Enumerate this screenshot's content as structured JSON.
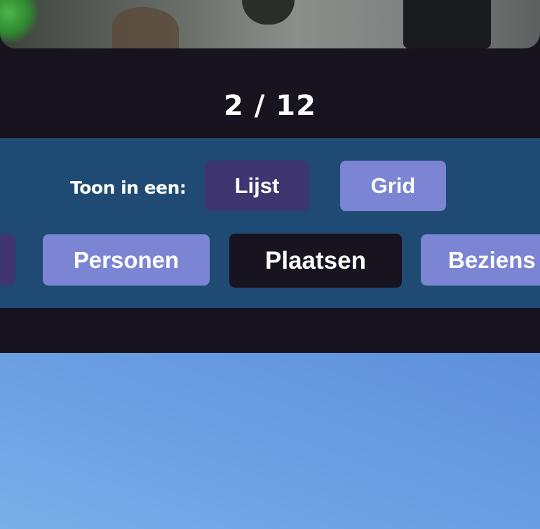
{
  "gallery": {
    "counter": "2 / 12"
  },
  "view_toggle": {
    "label": "Toon in een:",
    "options": [
      "Lijst",
      "Grid"
    ],
    "selected": "Lijst"
  },
  "categories": {
    "items": [
      "Personen",
      "Plaatsen",
      "Beziens"
    ],
    "active": "Plaatsen"
  },
  "colors": {
    "background": "#17131f",
    "panel": "#1e4a74",
    "button": "#7b85d4",
    "button_selected": "#3f3571",
    "category_active": "#17131f",
    "sky": "#6a9ee2"
  }
}
